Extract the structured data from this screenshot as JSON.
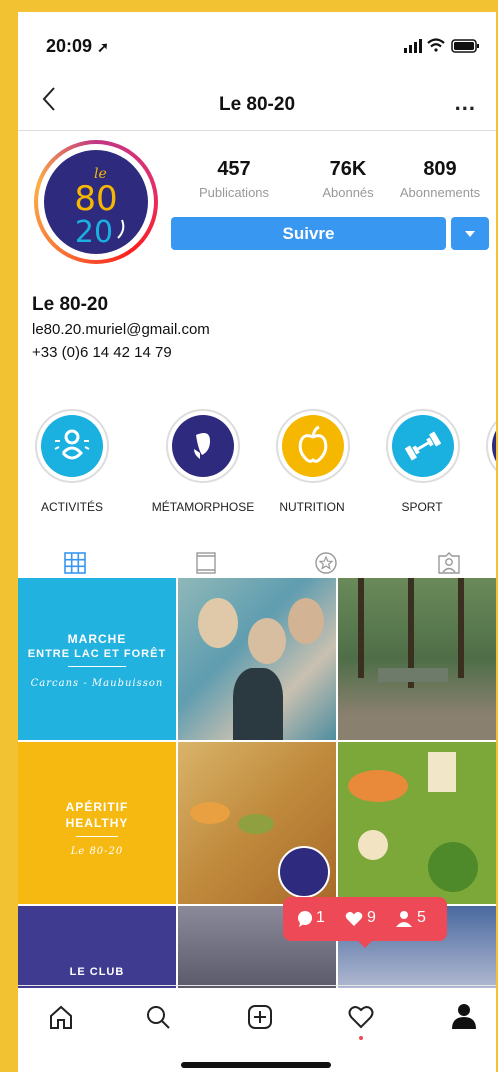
{
  "status_bar": {
    "time": "20:09"
  },
  "nav": {
    "title": "Le 80-20",
    "more": "..."
  },
  "profile": {
    "avatar_text_top": "le",
    "avatar_text_mid": "80",
    "avatar_text_bot": "20",
    "stats": [
      {
        "value": "457",
        "label": "Publications"
      },
      {
        "value": "76K",
        "label": "Abonnés"
      },
      {
        "value": "809",
        "label": "Abonnements"
      }
    ],
    "follow_label": "Suivre",
    "name": "Le 80-20",
    "email": "le80.20.muriel@gmail.com",
    "phone": "+33 (0)6 14 42 14 79"
  },
  "highlights": [
    {
      "label": "ACTIVITÉS",
      "color": "#1ab0e0",
      "icon": "activity-figure-icon"
    },
    {
      "label": "MÉTAMORPHOSE",
      "color": "#2e2a7e",
      "icon": "butterfly-icon"
    },
    {
      "label": "NUTRITION",
      "color": "#f5b700",
      "icon": "apple-icon"
    },
    {
      "label": "SPORT",
      "color": "#1ab0e0",
      "icon": "dumbbell-icon"
    }
  ],
  "posts": {
    "p1_line1": "MARCHE",
    "p1_line2": "ENTRE LAC ET FORÊT",
    "p1_sub": "Carcans - Maubuisson",
    "p4_line1": "APÉRITIF",
    "p4_line2": "HEALTHY",
    "p4_sub": "Le 80-20",
    "p7_line1": "LE CLUB"
  },
  "activity": {
    "comments": "1",
    "likes": "9",
    "follows": "5"
  },
  "colors": {
    "accent": "#3897f0",
    "notify": "#ed4956",
    "border": "#f2c233"
  }
}
